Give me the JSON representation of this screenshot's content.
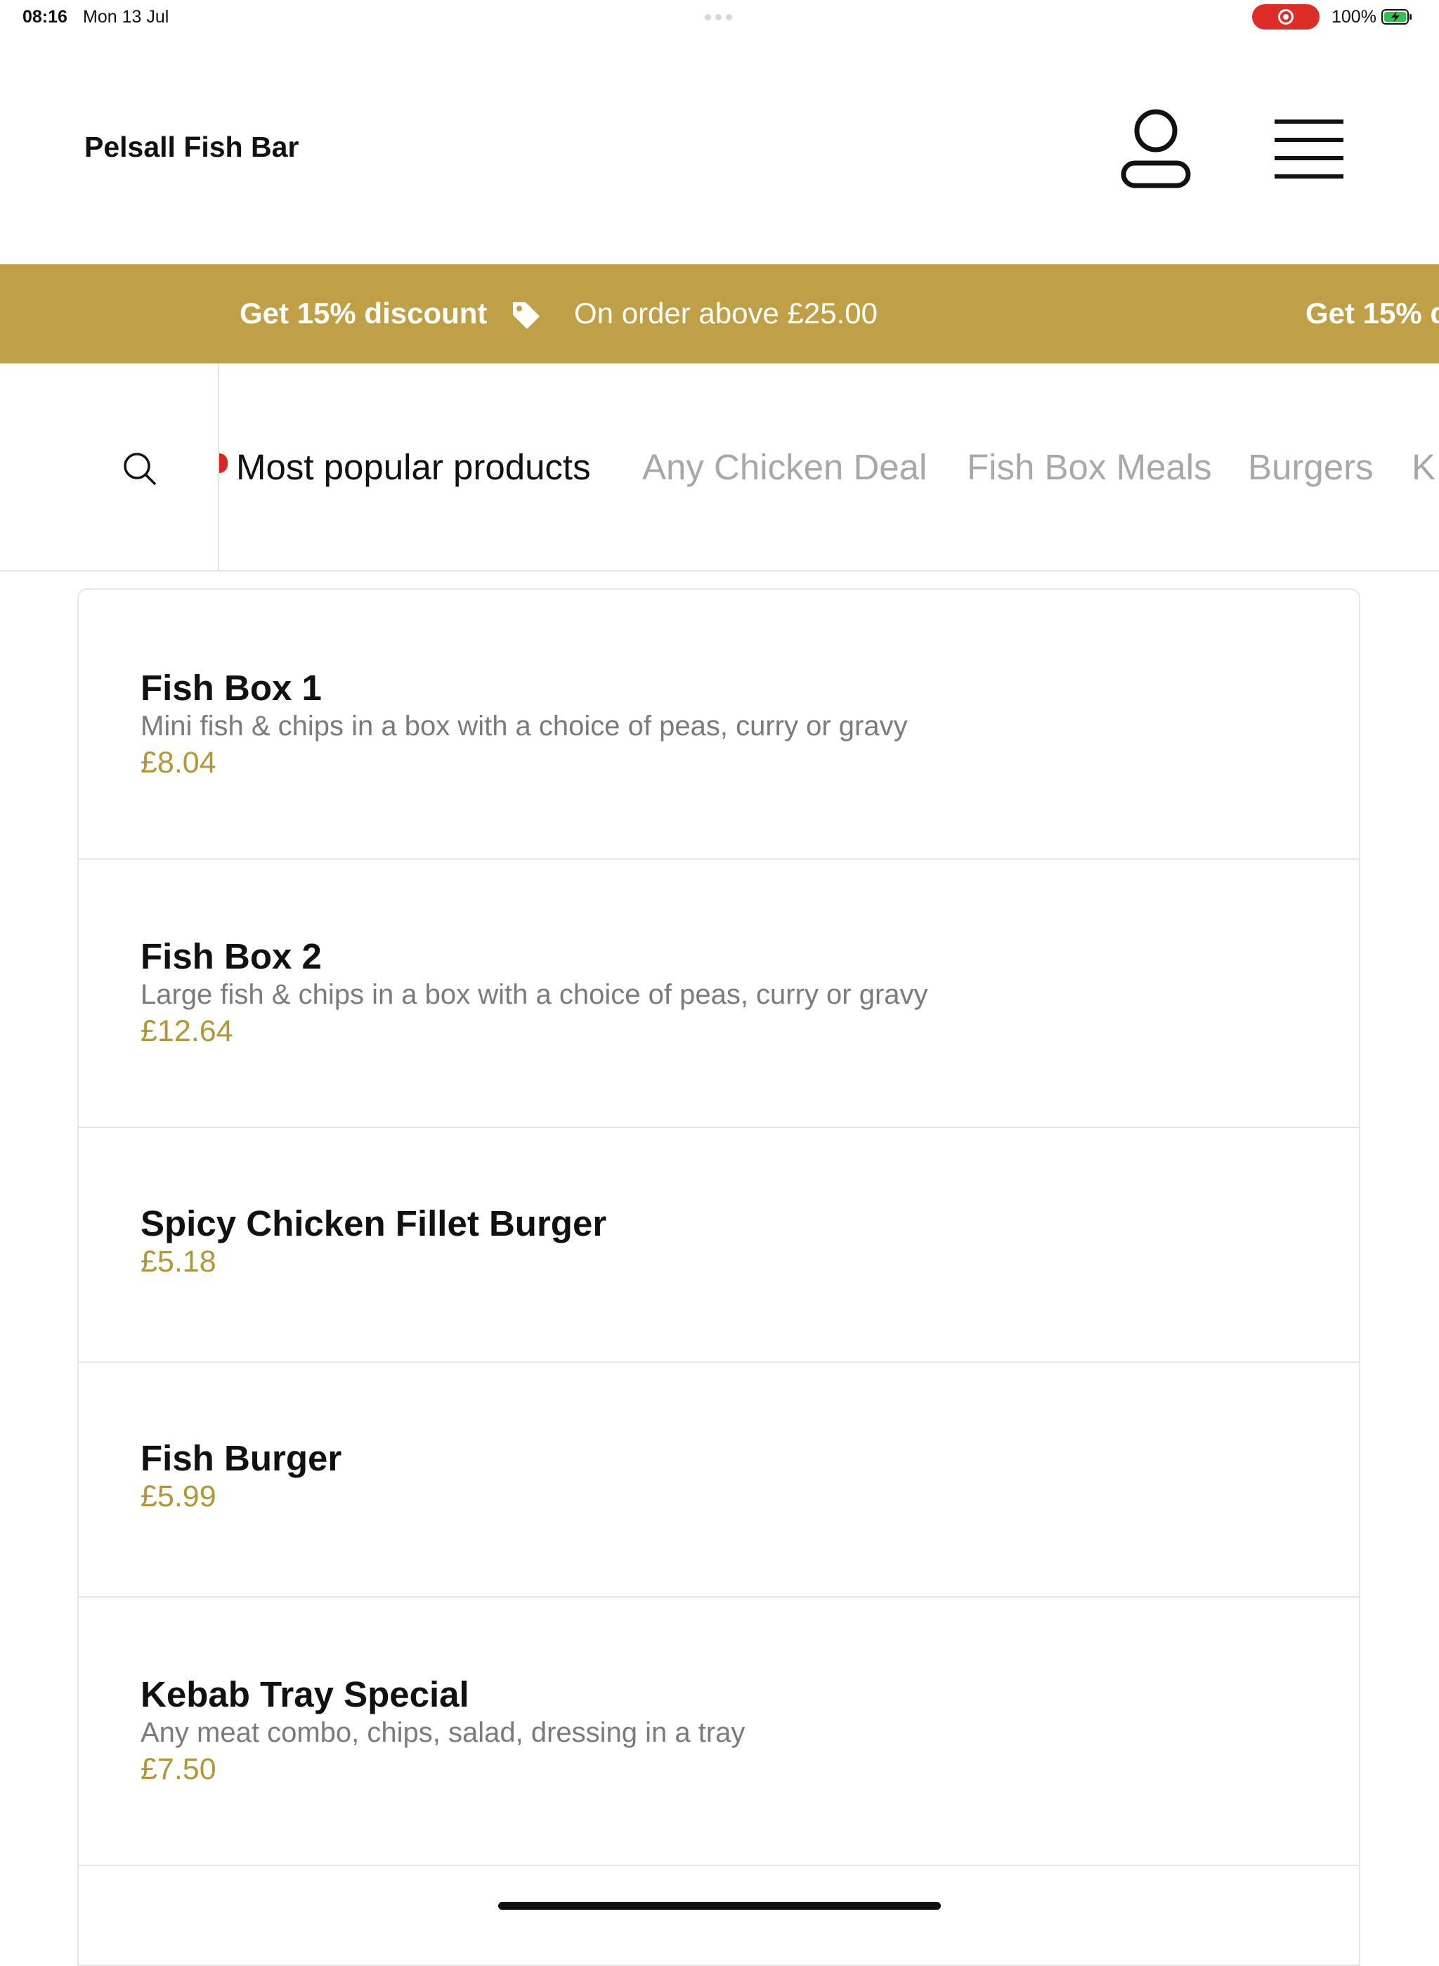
{
  "status_bar": {
    "time": "08:16",
    "date": "Mon 13 Jul",
    "battery": "100%"
  },
  "header": {
    "brand": "Pelsall Fish Bar",
    "user_icon": "user-icon",
    "menu_icon": "hamburger-menu-icon"
  },
  "promo": {
    "headline": "Get 15% discount",
    "condition": "On order above £25.00",
    "repeat_headline": "Get 15% d",
    "icon": "tag-icon",
    "color": "#bfa046"
  },
  "categories": {
    "search_icon": "search-icon",
    "tabs": [
      {
        "label": "Most popular products"
      },
      {
        "label": "Any Chicken Deal"
      },
      {
        "label": "Fish Box Meals"
      },
      {
        "label": "Burgers"
      },
      {
        "label": "K"
      }
    ]
  },
  "products": [
    {
      "name": "Fish Box 1",
      "description": "Mini fish & chips in a box with a choice of peas, curry or gravy",
      "price": "£8.04"
    },
    {
      "name": "Fish Box 2",
      "description": "Large fish & chips in a box with a choice of peas, curry or gravy",
      "price": "£12.64"
    },
    {
      "name": "Spicy Chicken Fillet Burger",
      "price": "£5.18"
    },
    {
      "name": "Fish Burger",
      "price": "£5.99"
    },
    {
      "name": "Kebab Tray Special",
      "description": "Any meat combo, chips, salad, dressing in a tray",
      "price": "£7.50"
    }
  ],
  "colors": {
    "accent": "#bfa046",
    "price": "#b39637",
    "recording": "#dc2e27"
  }
}
